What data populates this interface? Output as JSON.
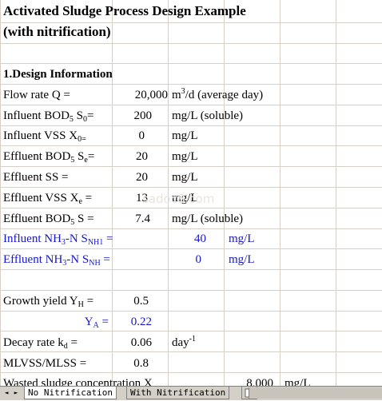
{
  "title_line1": "Activated Sludge Process Design Example",
  "title_line2": "(with nitrification)",
  "section1": "1.Design Information",
  "rows": [
    {
      "label": "Flow rate Q =",
      "value": "20,000",
      "unit_pre": "m",
      "unit_sup": "3",
      "unit_post": "/d (average day)"
    },
    {
      "label_pre": "Influent BOD",
      "label_sub": "5",
      "label_mid": " S",
      "label_sub2": "0",
      "label_post": "=",
      "value": "200",
      "unit": "mg/L (soluble)"
    },
    {
      "label_pre": "Influent VSS X",
      "label_sub": "0=",
      "value": "0",
      "unit": "mg/L"
    },
    {
      "label_pre": "Effluent BOD",
      "label_sub": "5",
      "label_mid": " S",
      "label_sub2": "e",
      "label_post": "=",
      "value": "20",
      "unit": "mg/L"
    },
    {
      "label": "Effluent SS =",
      "value": "20",
      "unit": "mg/L"
    },
    {
      "label_pre": "Effluent VSS X",
      "label_sub": "e",
      "label_post": " =",
      "value": "13",
      "unit": "mg/L"
    },
    {
      "label_pre": "Effluent BOD",
      "label_sub": "5",
      "label_post": " S =",
      "value": "7.4",
      "unit": "mg/L (soluble)"
    },
    {
      "label_pre": "Influent NH",
      "label_sub": "3",
      "label_mid": "-N S",
      "label_sub2": "NH1",
      "label_post": " =",
      "value": "40",
      "unit": "mg/L"
    },
    {
      "label_pre": "Effluent NH",
      "label_sub": "3",
      "label_mid": "-N S",
      "label_sub2": "NH",
      "label_post": " =",
      "value": "0",
      "unit": "mg/L"
    }
  ],
  "growth_yield_label_pre": "Growth yield Y",
  "growth_yield_label_sub": "H",
  "growth_yield_label_post": " =",
  "growth_yield_value": "0.5",
  "ya_label_pre": "Y",
  "ya_label_sub": "A",
  "ya_label_post": " =",
  "ya_value": "0.22",
  "decay_label_pre": "Decay rate k",
  "decay_label_sub": "d",
  "decay_label_post": " =",
  "decay_value": "0.06",
  "decay_unit_pre": "day",
  "decay_unit_sup": "-1",
  "mlvss_label": "MLVSS/MLSS =",
  "mlvss_value": "0.8",
  "wasted_label": "Wasted sludge concentration X",
  "wasted_value": "8,000",
  "wasted_unit": "mg/L",
  "watermark": "sadoc8.com",
  "tabs": {
    "nav_first": "◄",
    "nav_last": "►",
    "tab1": "No Nitrification",
    "tab2": "With Nitrification"
  },
  "colors": {
    "grid": "#d4d0c8",
    "blue_text": "#1515d6",
    "tab_bg": "#d4d0c8"
  }
}
